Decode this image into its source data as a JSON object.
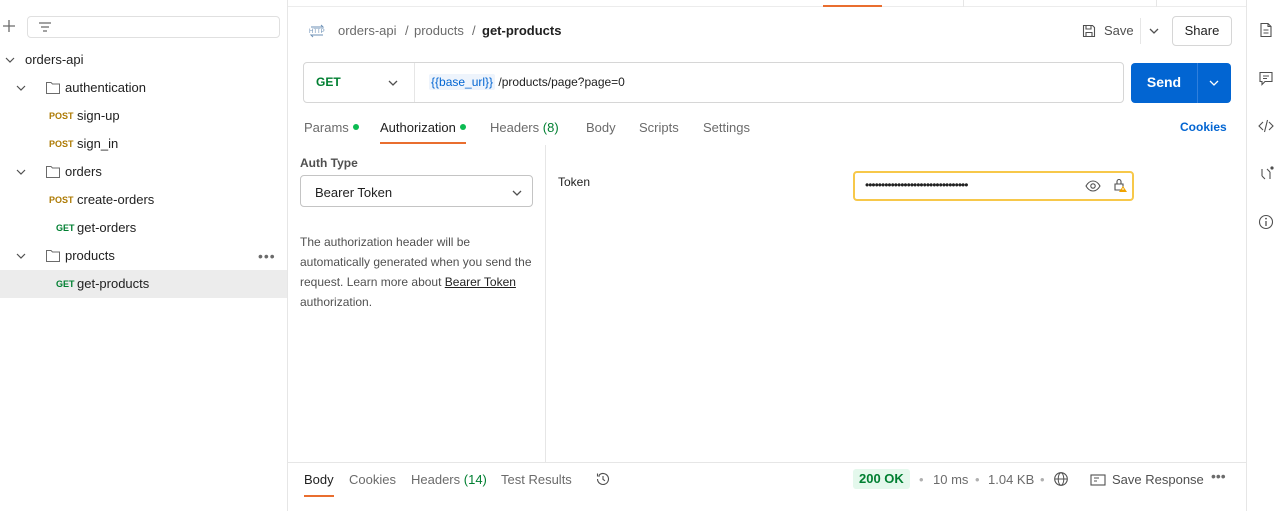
{
  "sidebar": {
    "tree": [
      {
        "label": "orders-api"
      },
      {
        "label": "authentication"
      },
      {
        "method": "POST",
        "label": "sign-up"
      },
      {
        "method": "POST",
        "label": "sign_in"
      },
      {
        "label": "orders"
      },
      {
        "method": "POST",
        "label": "create-orders"
      },
      {
        "method": "GET",
        "label": "get-orders"
      },
      {
        "label": "products"
      },
      {
        "method": "GET",
        "label": "get-products"
      }
    ],
    "more": "•••"
  },
  "breadcrumb": {
    "icon": "http-icon",
    "parts": [
      "orders-api",
      "/",
      "products",
      "/",
      "get-products"
    ]
  },
  "toolbar": {
    "save_label": "Save",
    "share_label": "Share"
  },
  "request": {
    "method": "GET",
    "url_var": "{{base_url}}",
    "url_path": "/products/page?page=0",
    "send_label": "Send"
  },
  "tabs": [
    {
      "label": "Params"
    },
    {
      "label": "Authorization"
    },
    {
      "label": "Headers",
      "count": "(8)"
    },
    {
      "label": "Body"
    },
    {
      "label": "Scripts"
    },
    {
      "label": "Settings"
    }
  ],
  "cookies_label": "Cookies",
  "auth": {
    "type_label": "Auth Type",
    "type_value": "Bearer Token",
    "desc_1": "The authorization header will be automatically generated when you send the request. Learn more about",
    "desc_link": "Bearer Token",
    "desc_2": "authorization.",
    "token_label": "Token",
    "token_masked": "••••••••••••••••••••••••••••••••"
  },
  "response": {
    "tabs": [
      {
        "label": "Body"
      },
      {
        "label": "Cookies"
      },
      {
        "label": "Headers",
        "count": "(14)"
      },
      {
        "label": "Test Results"
      }
    ],
    "status": "200 OK",
    "time": "10 ms",
    "size": "1.04 KB",
    "save_label": "Save Response",
    "separator": "•",
    "more": "•••"
  },
  "colors": {
    "accent": "#e96e2f",
    "primary": "#0265d2",
    "get": "#007f31",
    "post": "#ad7a03",
    "warning_border": "#f7c84a"
  }
}
